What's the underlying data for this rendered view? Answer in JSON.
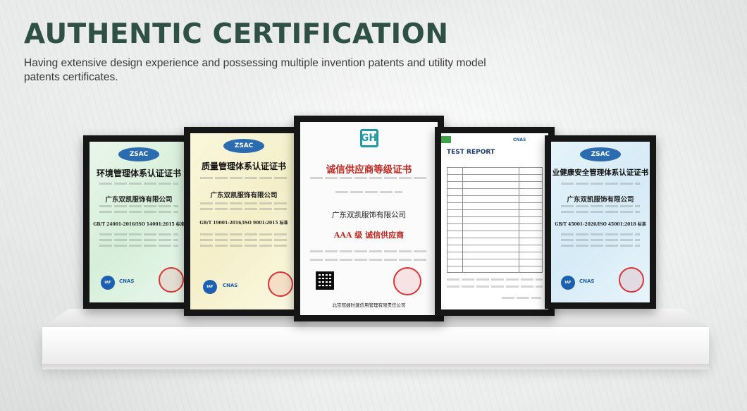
{
  "header": {
    "title": "AUTHENTIC CERTIFICATION",
    "subtitle": "Having extensive design experience and possessing multiple invention patents and utility model patents certificates."
  },
  "colors": {
    "title": "#2f5045",
    "subtitle": "#3a3a3a",
    "frame": "#161616",
    "red_accent": "#c4271f"
  },
  "certificates": [
    {
      "name": "environmental",
      "logo": "ZSAC",
      "title": "环境管理体系认证证书",
      "company": "广东双凯服饰有限公司",
      "standard": "GB/T 24001-2016/ISO 14001:2015 标准"
    },
    {
      "name": "quality",
      "logo": "ZSAC",
      "title": "质量管理体系认证证书",
      "company": "广东双凯服饰有限公司",
      "standard": "GB/T 19001-2016/ISO 9001:2015 标准"
    },
    {
      "name": "credit-supplier",
      "logo": "GH",
      "title": "诚信供应商等级证书",
      "company": "广东双凯服饰有限公司",
      "grade": "AAA 级 诚信供应商",
      "issuer": "北京冠捷时速信用管理有限责任公司"
    },
    {
      "name": "test-report",
      "title": "TEST REPORT"
    },
    {
      "name": "occupational-health",
      "logo": "ZSAC",
      "title": "业健康安全管理体系认证证书",
      "company": "广东双凯服饰有限公司",
      "standard": "GB/T 45001-2020/ISO 45001:2018 标准"
    }
  ]
}
